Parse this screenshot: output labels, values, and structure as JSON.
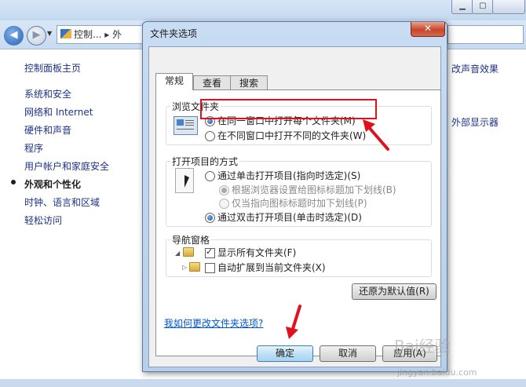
{
  "background": {
    "address_text": "控制... ▸ 外",
    "side_home": "控制面板主页",
    "side_items": [
      "系统和安全",
      "网络和 Internet",
      "硬件和声音",
      "程序",
      "用户帐户和家庭安全",
      "外观和个性化",
      "时钟、语言和区域",
      "轻松访问"
    ],
    "right_links": [
      "改声音效果",
      "外部显示器"
    ]
  },
  "dialog": {
    "title": "文件夹选项",
    "close_label": "✕",
    "tabs": [
      "常规",
      "查看",
      "搜索"
    ],
    "browse": {
      "title": "浏览文件夹",
      "opt1": "在同一窗口中打开每个文件夹(M)",
      "opt2": "在不同窗口中打开不同的文件夹(W)"
    },
    "click": {
      "title": "打开项目的方式",
      "single": "通过单击打开项目(指向时选定)(S)",
      "sub1": "根据浏览器设置给图标标题加下划线(B)",
      "sub2": "仅当指向图标标题时加下划线(P)",
      "double": "通过双击打开项目(单击时选定)(D)"
    },
    "nav": {
      "title": "导航窗格",
      "show_all": "显示所有文件夹(F)",
      "auto_expand": "自动扩展到当前文件夹(X)"
    },
    "restore_label": "还原为默认值(R)",
    "help_link": "我如何更改文件夹选项?",
    "ok_label": "确定",
    "cancel_label": "取消",
    "apply_label": "应用(A)"
  },
  "watermark": {
    "text": "Bai经验",
    "url": "jingyan.baidu.com"
  }
}
